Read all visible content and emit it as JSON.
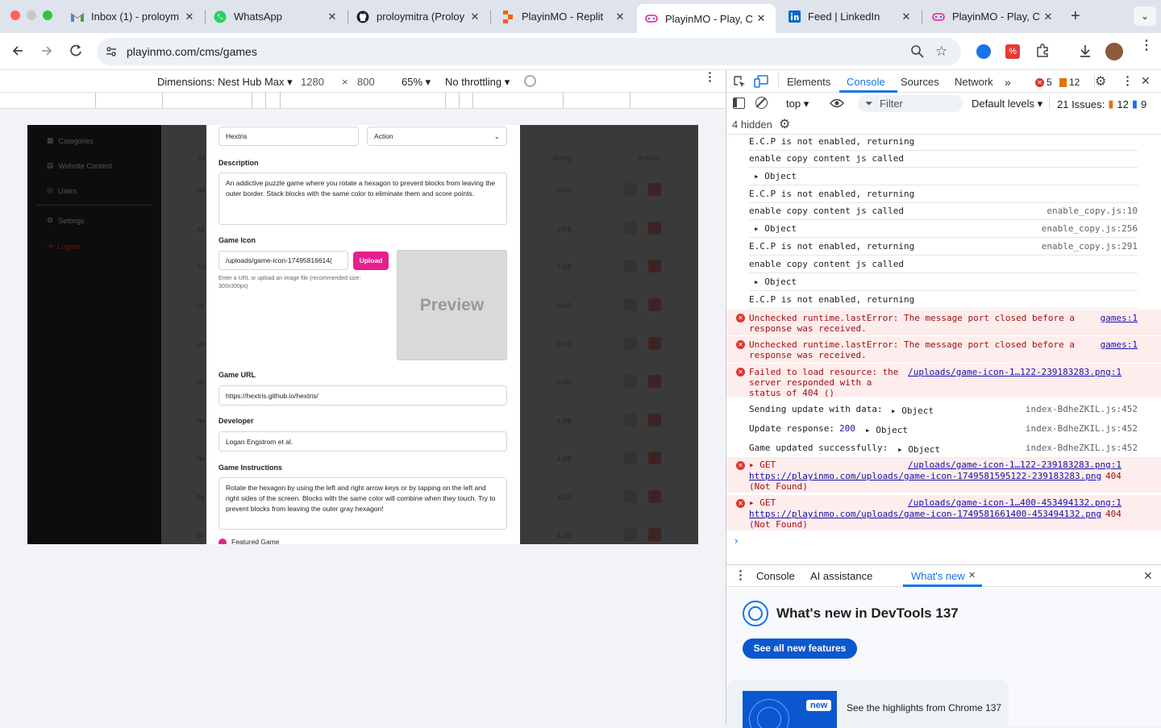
{
  "tabs": [
    {
      "title": "Inbox (1) - proloym",
      "icon": "gmail-icon",
      "active": false
    },
    {
      "title": "WhatsApp",
      "icon": "whatsapp-icon",
      "active": false
    },
    {
      "title": "proloymitra (Proloy",
      "icon": "github-icon",
      "active": false
    },
    {
      "title": "PlayinMO - Replit",
      "icon": "replit-icon",
      "active": false
    },
    {
      "title": "PlayinMO - Play, C",
      "icon": "playinmo-icon",
      "active": true
    },
    {
      "title": "Feed | LinkedIn",
      "icon": "linkedin-icon",
      "active": false
    },
    {
      "title": "PlayinMO - Play, C",
      "icon": "playinmo-icon",
      "active": false
    }
  ],
  "address": {
    "url": "playinmo.com/cms/games"
  },
  "device_toolbar": {
    "dimensions_label": "Dimensions: Nest Hub Max",
    "width": "1280",
    "times": "×",
    "height": "800",
    "zoom": "65%",
    "throttling": "No throttling"
  },
  "app": {
    "sidebar": [
      {
        "label": "Categories",
        "icon": "grid-icon"
      },
      {
        "label": "Website Content",
        "icon": "file-icon"
      },
      {
        "label": "Users",
        "icon": "users-icon"
      },
      {
        "label": "Settings",
        "icon": "gear-icon"
      },
      {
        "label": "Logout",
        "icon": "logout-icon"
      }
    ],
    "table_headers": {
      "title": "Titl",
      "rating": "Rating",
      "actions": "Actions"
    },
    "rows": [
      {
        "title": "Ge",
        "rating": "0.0/5"
      },
      {
        "title": "Sp",
        "rating": "0.0/5"
      },
      {
        "title": "204",
        "rating": "0.0/5"
      },
      {
        "title": "Cr",
        "rating": "0.0/5"
      },
      {
        "title": "Un",
        "rating": "0.0/5"
      },
      {
        "title": "Mi",
        "rating": "0.0/5"
      },
      {
        "title": "He",
        "rating": "4.3/5"
      },
      {
        "title": "He",
        "rating": "4.2/5"
      },
      {
        "title": "Pa",
        "rating": "4.5/5"
      },
      {
        "title": "Sn",
        "rating": "4.3/5"
      }
    ]
  },
  "modal": {
    "title_value": "Hextris",
    "category_value": "Action",
    "description_label": "Description",
    "description_value": "An addictive puzzle game where you rotate a hexagon to prevent blocks from leaving the outer border. Stack blocks with the same color to eliminate them and score points.",
    "icon_label": "Game Icon",
    "icon_value": "/uploads/game-icon-17495816614(",
    "upload_label": "Upload",
    "icon_hint": "Enter a URL or upload an image file (recommended size: 300x300px)",
    "preview_label": "Preview",
    "url_label": "Game URL",
    "url_value": "https://hextris.github.io/hextris/",
    "developer_label": "Developer",
    "developer_value": "Logan Engstrom et al.",
    "instructions_label": "Game Instructions",
    "instructions_value": "Rotate the hexagon by using the left and right arrow keys or by tapping on the left and right sides of the screen. Blocks with the same color will combine when they touch. Try to prevent blocks from leaving the outer gray hexagon!",
    "featured_label": "Featured Game",
    "accent_color": "#e91e8c"
  },
  "devtools": {
    "tabs": [
      "Elements",
      "Console",
      "Sources",
      "Network"
    ],
    "active_tab": "Console",
    "error_count": "5",
    "warning_count": "12",
    "context": "top",
    "filter_placeholder": "Filter",
    "levels": "Default levels",
    "issues_label": "21 Issues:",
    "issues_warn": "12",
    "issues_info": "9",
    "hidden": "4 hidden",
    "log": [
      {
        "text": "E.C.P is not enabled, returning",
        "src": "",
        "type": "log"
      },
      {
        "text": "enable copy content js called",
        "src": "",
        "type": "log"
      },
      {
        "text": "▸ Object",
        "src": "",
        "type": "log"
      },
      {
        "text": "E.C.P is not enabled, returning",
        "src": "",
        "type": "log"
      },
      {
        "text": "enable copy content js called",
        "src": "enable_copy.js:10",
        "type": "log"
      },
      {
        "text": "▸ Object",
        "src": "enable_copy.js:256",
        "type": "log"
      },
      {
        "text": "E.C.P is not enabled, returning",
        "src": "enable_copy.js:291",
        "type": "log"
      },
      {
        "text": "enable copy content js called",
        "src": "",
        "type": "log"
      },
      {
        "text": "▸ Object",
        "src": "",
        "type": "log"
      },
      {
        "text": "E.C.P is not enabled, returning",
        "src": "",
        "type": "log"
      }
    ],
    "errors": [
      {
        "line1": "Unchecked runtime.lastError: The message port closed before a",
        "line2": "response was received.",
        "src": "games:1"
      },
      {
        "line1": "Unchecked runtime.lastError: The message port closed before a",
        "line2": "response was received.",
        "src": "games:1"
      },
      {
        "line1": "Failed to load resource: the",
        "line2": "server responded with a",
        "line3": "status of 404 ()",
        "src": "/uploads/game-icon-1…122-239183283.png:1"
      }
    ],
    "updates": [
      {
        "text": "Sending update with data:",
        "obj": "▸ Object",
        "src": "index-BdheZKIL.js:452"
      },
      {
        "text": "Update response:",
        "num": "200",
        "obj": "▸ Object",
        "src": "index-BdheZKIL.js:452"
      },
      {
        "text": "Game updated successfully:",
        "obj": "▸ Object",
        "src": "index-BdheZKIL.js:452"
      }
    ],
    "gets": [
      {
        "line1": "▸ GET",
        "src": "/uploads/game-icon-1…122-239183283.png:1",
        "url": "https://playinmo.com/uploads/game-icon-1749581595122-239183283.png",
        "code": "404",
        "status": "(Not Found)"
      },
      {
        "line1": "▸ GET",
        "src": "/uploads/game-icon-1…400-453494132.png:1",
        "url": "https://playinmo.com/uploads/game-icon-1749581661400-453494132.png",
        "code": "404",
        "status": "(Not Found)"
      }
    ],
    "drawer": {
      "tabs": [
        "Console",
        "AI assistance",
        "What's new"
      ],
      "heading": "What's new in DevTools 137",
      "button": "See all new features",
      "card_text": "See the highlights from Chrome 137",
      "badge": "new"
    }
  }
}
